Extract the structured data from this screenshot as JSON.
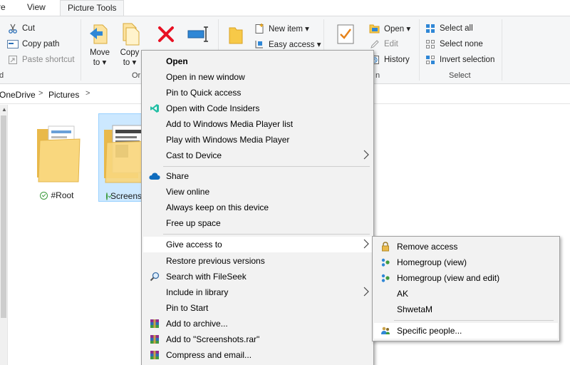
{
  "ribbon": {
    "tabs": [
      "re",
      "View",
      "Picture Tools"
    ],
    "clipboard": {
      "cut": "Cut",
      "copy_path": "Copy path",
      "paste_shortcut": "Paste shortcut",
      "group_label": "d"
    },
    "organize": {
      "move_to": "Move",
      "move_to_2": "to ▾",
      "copy_to": "Copy",
      "copy_to_2": "to ▾",
      "group_label": "Or"
    },
    "new": {
      "new_item": "New item ▾",
      "easy_access": "Easy access ▾"
    },
    "open": {
      "open": "Open ▾",
      "edit": "Edit",
      "history": "History",
      "group_label": "n"
    },
    "select": {
      "select_all": "Select all",
      "select_none": "Select none",
      "invert": "Invert selection",
      "group_label": "Select"
    }
  },
  "address": {
    "crumb1": "OneDrive",
    "crumb2": "Pictures",
    "sep": ">"
  },
  "files": [
    {
      "name": "#Root"
    },
    {
      "name": "Screenshots"
    }
  ],
  "context_menu": [
    "Open",
    "Open in new window",
    "Pin to Quick access",
    "Open with Code Insiders",
    "Add to Windows Media Player list",
    "Play with Windows Media Player",
    "Cast to Device",
    "Share",
    "View online",
    "Always keep on this device",
    "Free up space",
    "Give access to",
    "Restore previous versions",
    "Search with FileSeek",
    "Include in library",
    "Pin to Start",
    "Add to archive...",
    "Add to \"Screenshots.rar\"",
    "Compress and email..."
  ],
  "submenu": [
    "Remove access",
    "Homegroup (view)",
    "Homegroup (view and edit)",
    "AK",
    "ShwetaM",
    "Specific people..."
  ],
  "colors": {
    "accent_blue": "#0078d7",
    "highlight": "#cce8ff",
    "delete_red": "#e81123",
    "sync_green": "#3c9b3c"
  }
}
